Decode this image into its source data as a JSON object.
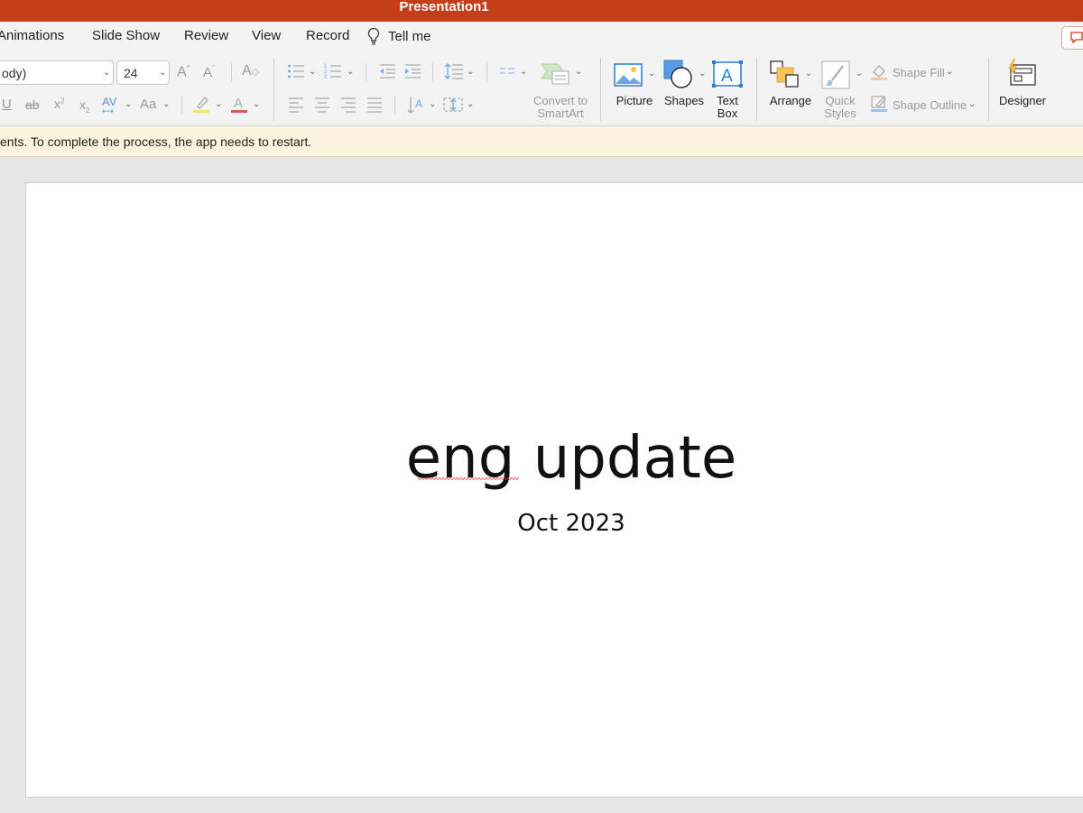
{
  "window": {
    "title": "Presentation1"
  },
  "tabs": [
    "Animations",
    "Slide Show",
    "Review",
    "View",
    "Record"
  ],
  "tell_me": "Tell me",
  "ribbon": {
    "font_name": "ody)",
    "font_size": "24",
    "convert_smartart_line1": "Convert to",
    "convert_smartart_line2": "SmartArt",
    "picture": "Picture",
    "shapes": "Shapes",
    "text_box_line1": "Text",
    "text_box_line2": "Box",
    "arrange": "Arrange",
    "quick_styles_line1": "Quick",
    "quick_styles_line2": "Styles",
    "shape_fill": "Shape Fill",
    "shape_outline": "Shape Outline",
    "designer": "Designer"
  },
  "notification": "ents. To complete the process, the app needs to restart.",
  "slide": {
    "title": "eng update",
    "subtitle": "Oct 2023"
  },
  "colors": {
    "titlebar": "#c43e1c",
    "notice_bg": "#fdf4df",
    "accent_blue": "#2b7cd3"
  }
}
